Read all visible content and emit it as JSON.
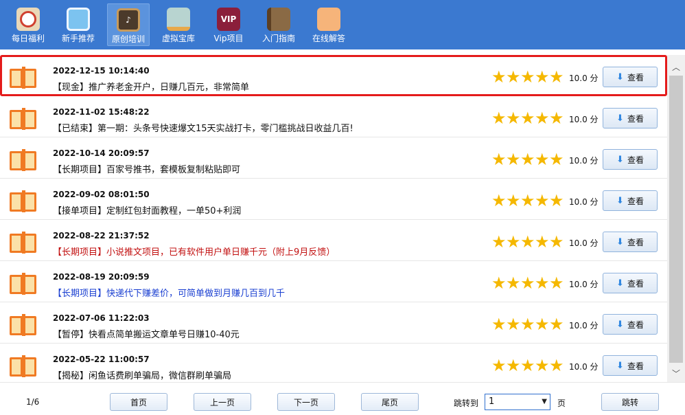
{
  "toolbar": {
    "items": [
      {
        "label": "每日福利",
        "icon": "lucky-cat-icon"
      },
      {
        "label": "新手推荐",
        "icon": "computer-icon"
      },
      {
        "label": "原创培训",
        "icon": "blackboard-icon",
        "active": true
      },
      {
        "label": "虚拟宝库",
        "icon": "warehouse-icon"
      },
      {
        "label": "Vip项目",
        "icon": "vip-icon",
        "icon_text": "VIP"
      },
      {
        "label": "入门指南",
        "icon": "book-icon"
      },
      {
        "label": "在线解答",
        "icon": "support-girl-icon"
      }
    ]
  },
  "list": {
    "items": [
      {
        "date": "2022-12-15 10:14:40",
        "title": "【现金】推广养老金开户，日赚几百元，非常简单",
        "style": "normal",
        "rating": 5,
        "score": "10.0 分",
        "button": "查看",
        "selected": true
      },
      {
        "date": "2022-11-02 15:48:22",
        "title": "【已结束】第一期：头条号快速爆文15天实战打卡，零门槛挑战日收益几百!",
        "style": "normal",
        "rating": 5,
        "score": "10.0 分",
        "button": "查看"
      },
      {
        "date": "2022-10-14 20:09:57",
        "title": "【长期项目】百家号推书，套模板复制粘贴即可",
        "style": "normal",
        "rating": 5,
        "score": "10.0 分",
        "button": "查看"
      },
      {
        "date": "2022-09-02 08:01:50",
        "title": "【接单项目】定制红包封面教程，一单50+利润",
        "style": "normal",
        "rating": 5,
        "score": "10.0 分",
        "button": "查看"
      },
      {
        "date": "2022-08-22 21:37:52",
        "title": "【长期项目】小说推文项目，已有软件用户单日赚千元（附上9月反馈）",
        "style": "red",
        "rating": 5,
        "score": "10.0 分",
        "button": "查看"
      },
      {
        "date": "2022-08-19 20:09:59",
        "title": "【长期项目】快递代下赚差价，可简单做到月赚几百到几千",
        "style": "blue",
        "rating": 5,
        "score": "10.0 分",
        "button": "查看"
      },
      {
        "date": "2022-07-06 11:22:03",
        "title": "【暂停】快看点简单搬运文章单号日赚10-40元",
        "style": "normal",
        "rating": 5,
        "score": "10.0 分",
        "button": "查看"
      },
      {
        "date": "2022-05-22 11:00:57",
        "title": "【揭秘】闲鱼话费刷单骗局，微信群刷单骗局",
        "style": "normal",
        "rating": 5,
        "score": "10.0 分",
        "button": "查看"
      }
    ]
  },
  "pager": {
    "info": "1/6",
    "first": "首页",
    "prev": "上一页",
    "next": "下一页",
    "last": "尾页",
    "jump_label": "跳转到",
    "jump_value": "1",
    "page_unit": "页",
    "jump_button": "跳转"
  },
  "colors": {
    "toolbar_bg": "#3b79d0",
    "selected_border": "#e41b1b",
    "star": "#f5b800",
    "title_red": "#c21010",
    "title_blue": "#1a3fd1"
  }
}
